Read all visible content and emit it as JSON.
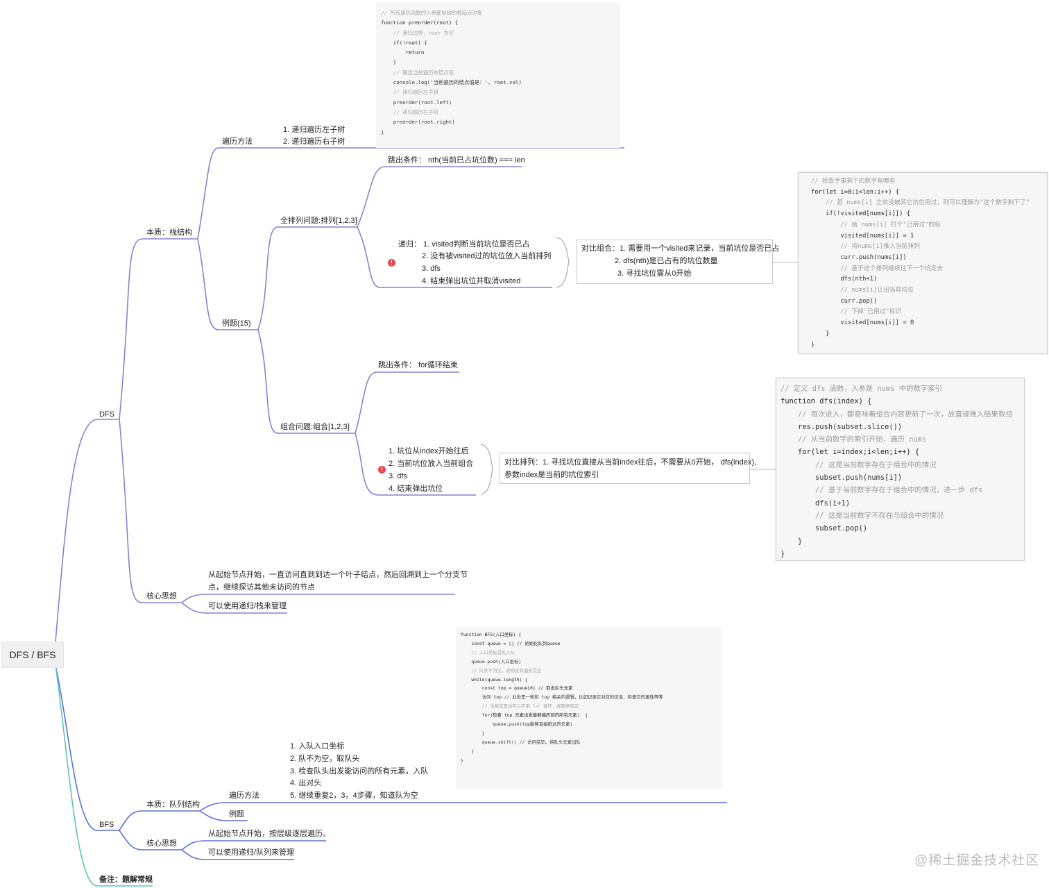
{
  "root": "DFS / BFS",
  "dfs": {
    "label": "DFS",
    "stack": {
      "label": "本质：栈结构",
      "traverse_label": "遍历方法",
      "traverse_items": [
        "1.  递归遍历左子树",
        "2.  递归遍历右子树"
      ],
      "traverse_code": [
        "// 所有遍历函数的入参都是树的根结点对象",
        "function preorder(root) {",
        "    // 递归边界，root 为空",
        "    if(!root) {",
        "        return",
        "    }",
        "",
        "    // 输出当前遍历的结点值",
        "    console.log('当前遍历的结点值是：', root.val)",
        "    // 递归遍历左子树",
        "    preorder(root.left)",
        "    // 递归遍历右子树",
        "    preorder(root.right)",
        "}"
      ],
      "examples_label": "例题(15)",
      "perm": {
        "label": "全排列问题:排列[1,2,3]",
        "exit": "跳出条件：  nth(当前已占坑位数) === len",
        "recursion_lines": [
          "递归：  1.  visited判断当前坑位是否已占",
          "2.  没有被visited过的坑位放入当前排列",
          "3.  dfs",
          "4.  结束弹出坑位并取消visited"
        ],
        "compare_lines": [
          "对比组合：1.  需要用一个visited来记录，当前坑位是否已占",
          "2.  dfs(nth)是已占有的坑位数量",
          "3.  寻找坑位需从0开始"
        ],
        "code": [
          "// 检查手里剩下的数字有哪些",
          "for(let i=0;i<len;i++) {",
          "    // 若 nums[i] 之前没被其它坑位用过，则可以理解为\"这个数字剩下了\"",
          "    if(!visited[nums[i]]) {",
          "        // 给 nums[i] 打个\"已用过\"的标",
          "        visited[nums[i]] = 1",
          "        // 将nums[i]推入当前排列",
          "        curr.push(nums[i])",
          "        // 基于这个排列继续往下一个坑走去",
          "        dfs(nth+1)",
          "        // nums[i]让出当前坑位",
          "        curr.pop()",
          "        // 下掉\"已用过\"标识",
          "        visited[nums[i]] = 0",
          "    }",
          "}"
        ]
      },
      "comb": {
        "label": "组合问题:组合[1,2,3]",
        "exit": "跳出条件：  for循环结束",
        "steps": [
          "1.  坑位从index开始往后",
          "2.  当前坑位放入当前组合",
          "3.  dfs",
          "4.  结束弹出坑位"
        ],
        "compare_lines": [
          "对比排列：1. 寻找坑位直接从当前index往后，不需要从0开始，  dfs(index),",
          "参数index是当前的坑位索引"
        ],
        "code": [
          "// 定义 dfs 函数，入参是 nums 中的数字索引",
          "function dfs(index) {",
          "    // 每次进入，都意味着组合内容更新了一次，故直接推入结果数组",
          "    res.push(subset.slice())",
          "    // 从当前数字的索引开始，遍历 nums",
          "    for(let i=index;i<len;i++) {",
          "        // 这是当前数字存在于组合中的情况",
          "        subset.push(nums[i])",
          "        // 基于当前数字存在于组合中的情况，进一步 dfs",
          "        dfs(i+1)",
          "        // 这是当前数字不存在与组合中的情况",
          "        subset.pop()",
          "    }",
          "}"
        ]
      }
    },
    "core": {
      "label": "核心思想",
      "idea_lines": [
        "从起始节点开始，一直访问直到到达一个叶子结点，然后回溯到上一个分支节",
        "点，继续探访其他未访问的节点"
      ],
      "note": "可以使用递归/栈来管理"
    }
  },
  "bfs": {
    "label": "BFS",
    "queue": {
      "label": "本质：队列结构",
      "traverse_label": "遍历方法",
      "steps": [
        "1.  入队入口坐标",
        "2.  队不为空，取队头",
        "3.  检查队头出发能访问的所有元素，入队",
        "4.  出对头",
        "5.  继续重复2，3，4步骤，知道队为空"
      ],
      "examples_label": "例题",
      "code": [
        "function BFS(入口坐标) {",
        "    const queue = [] // 初始化队列queue",
        "    // 入口坐标首先入队",
        "    queue.push(入口坐标)",
        "    // 队列不为空，说明没有遍历完全",
        "    while(queue.length) {",
        "        const top = queue[0] // 取出队头元素",
        "",
        "        访问 top // 此处是一些和 top 相关的逻辑，比如记录它对应的信息、检查它的属性等等",
        "",
        "        // 注意这里也可以不用 for 循环，视题意而定",
        "        for(检查 top 元素出发能够遍历到的所有元素)  {",
        "            queue.push(top能够直接抵达的元素)",
        "        }",
        "",
        "        queue.shift() // 访问完毕。将队头元素出队",
        "    }",
        "}"
      ]
    },
    "core": {
      "label": "核心思想",
      "idea": "从起始节点开始，按层级逐层遍历。",
      "note": "可以使用递归/队列来管理"
    }
  },
  "remark": "备注：题解常规",
  "watermark": "@稀土掘金技术社区",
  "colors": {
    "dfs_branch": "#8b7fd0",
    "bfs_branch": "#5b6fd6",
    "remark_branch": "#5fc3b8",
    "badge": "#e5484d"
  }
}
